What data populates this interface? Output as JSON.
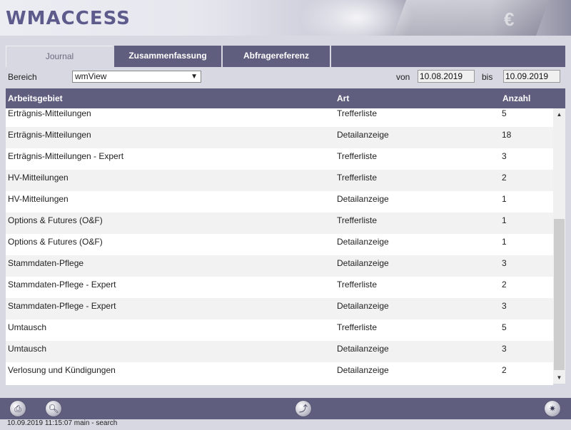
{
  "app": {
    "logo": "WMACCESS"
  },
  "tabs": [
    {
      "label": "Journal",
      "active": true
    },
    {
      "label": "Zusammenfassung",
      "active": false
    },
    {
      "label": "Abfragereferenz",
      "active": false
    }
  ],
  "filter": {
    "bereich_label": "Bereich",
    "bereich_value": "wmView",
    "von_label": "von",
    "von_value": "10.08.2019",
    "bis_label": "bis",
    "bis_value": "10.09.2019"
  },
  "table": {
    "columns": [
      "Arbeitsgebiet",
      "Art",
      "Anzahl"
    ],
    "rows": [
      [
        "Erträgnis-Mitteilungen",
        "Trefferliste",
        "5"
      ],
      [
        "Erträgnis-Mitteilungen",
        "Detailanzeige",
        "18"
      ],
      [
        "Erträgnis-Mitteilungen - Expert",
        "Trefferliste",
        "3"
      ],
      [
        "HV-Mitteilungen",
        "Trefferliste",
        "2"
      ],
      [
        "HV-Mitteilungen",
        "Detailanzeige",
        "1"
      ],
      [
        "Options & Futures (O&F)",
        "Trefferliste",
        "1"
      ],
      [
        "Options & Futures (O&F)",
        "Detailanzeige",
        "1"
      ],
      [
        "Stammdaten-Pflege",
        "Detailanzeige",
        "3"
      ],
      [
        "Stammdaten-Pflege - Expert",
        "Trefferliste",
        "2"
      ],
      [
        "Stammdaten-Pflege - Expert",
        "Detailanzeige",
        "3"
      ],
      [
        "Umtausch",
        "Trefferliste",
        "5"
      ],
      [
        "Umtausch",
        "Detailanzeige",
        "3"
      ],
      [
        "Verlosung und Kündigungen",
        "Detailanzeige",
        "2"
      ]
    ]
  },
  "toolbar": {
    "buttons": [
      "print-icon",
      "preview-icon",
      "export-icon",
      "settings-icon"
    ]
  },
  "status": {
    "text": "10.09.2019 11:15:07 main - search"
  },
  "colors": {
    "header_bar": "#5f5e7e",
    "logo": "#5d5a8c",
    "background": "#d8d8e2"
  }
}
